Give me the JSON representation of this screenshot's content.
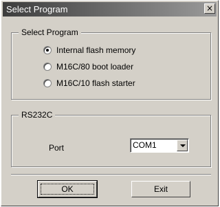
{
  "window": {
    "title": "Select Program",
    "close_glyph": "×"
  },
  "program_group": {
    "label": "Select Program",
    "options": [
      {
        "label": "Internal flash memory",
        "checked": true
      },
      {
        "label": "M16C/80 boot loader",
        "checked": false
      },
      {
        "label": "M16C/10 flash starter",
        "checked": false
      }
    ]
  },
  "rs232c_group": {
    "label": "RS232C",
    "port_label": "Port",
    "port_value": "COM1"
  },
  "buttons": {
    "ok": "OK",
    "exit": "Exit"
  }
}
